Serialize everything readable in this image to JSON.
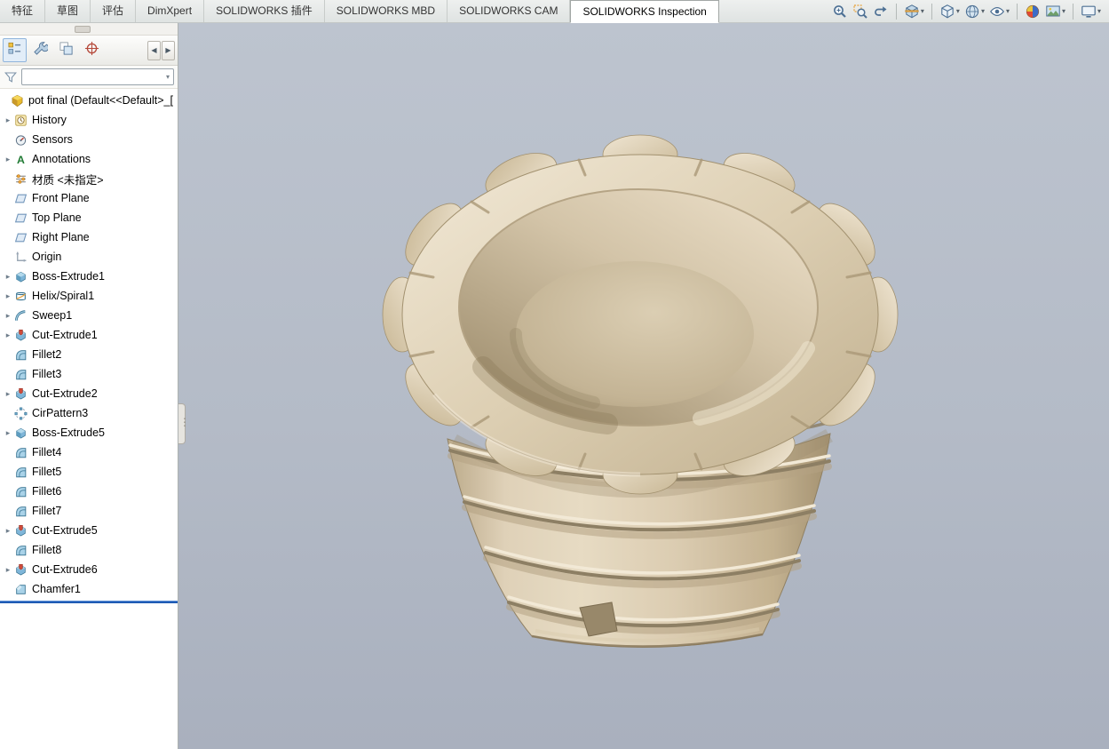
{
  "ribbon_tabs": [
    {
      "label": "特征",
      "active": false
    },
    {
      "label": "草图",
      "active": false
    },
    {
      "label": "评估",
      "active": false
    },
    {
      "label": "DimXpert",
      "active": false
    },
    {
      "label": "SOLIDWORKS 插件",
      "active": false
    },
    {
      "label": "SOLIDWORKS MBD",
      "active": false
    },
    {
      "label": "SOLIDWORKS CAM",
      "active": false
    },
    {
      "label": "SOLIDWORKS Inspection",
      "active": true
    }
  ],
  "view_toolbar": [
    {
      "name": "zoom-to-fit",
      "caret": false
    },
    {
      "name": "zoom-to-area",
      "caret": false
    },
    {
      "name": "previous-view",
      "caret": false
    },
    {
      "name": "section-view",
      "caret": true
    },
    {
      "name": "view-orientation",
      "caret": true
    },
    {
      "name": "display-style",
      "caret": true
    },
    {
      "name": "hide-show-items",
      "caret": true
    },
    {
      "name": "edit-appearance",
      "caret": false
    },
    {
      "name": "apply-scene",
      "caret": true
    },
    {
      "name": "view-settings",
      "caret": true
    }
  ],
  "panel": {
    "tabs": [
      "featuremanager-design-tree",
      "propertymanager",
      "configurationmanager",
      "dimxpertmanager"
    ],
    "filter_value": ""
  },
  "feature_tree": {
    "root_label": "pot final  (Default<<Default>_[",
    "items": [
      {
        "label": "History",
        "icon": "history",
        "arrow": true
      },
      {
        "label": "Sensors",
        "icon": "sensors",
        "arrow": false
      },
      {
        "label": "Annotations",
        "icon": "annotations",
        "arrow": true
      },
      {
        "label": "材质 <未指定>",
        "icon": "material",
        "arrow": false
      },
      {
        "label": "Front Plane",
        "icon": "plane",
        "arrow": false
      },
      {
        "label": "Top Plane",
        "icon": "plane",
        "arrow": false
      },
      {
        "label": "Right Plane",
        "icon": "plane",
        "arrow": false
      },
      {
        "label": "Origin",
        "icon": "origin",
        "arrow": false
      },
      {
        "label": "Boss-Extrude1",
        "icon": "boss-extrude",
        "arrow": true
      },
      {
        "label": "Helix/Spiral1",
        "icon": "helix",
        "arrow": true
      },
      {
        "label": "Sweep1",
        "icon": "sweep",
        "arrow": true
      },
      {
        "label": "Cut-Extrude1",
        "icon": "cut-extrude",
        "arrow": true
      },
      {
        "label": "Fillet2",
        "icon": "fillet",
        "arrow": false
      },
      {
        "label": "Fillet3",
        "icon": "fillet",
        "arrow": false
      },
      {
        "label": "Cut-Extrude2",
        "icon": "cut-extrude",
        "arrow": true
      },
      {
        "label": "CirPattern3",
        "icon": "cirpattern",
        "arrow": false
      },
      {
        "label": "Boss-Extrude5",
        "icon": "boss-extrude",
        "arrow": true
      },
      {
        "label": "Fillet4",
        "icon": "fillet",
        "arrow": false
      },
      {
        "label": "Fillet5",
        "icon": "fillet",
        "arrow": false
      },
      {
        "label": "Fillet6",
        "icon": "fillet",
        "arrow": false
      },
      {
        "label": "Fillet7",
        "icon": "fillet",
        "arrow": false
      },
      {
        "label": "Cut-Extrude5",
        "icon": "cut-extrude",
        "arrow": true
      },
      {
        "label": "Fillet8",
        "icon": "fillet",
        "arrow": false
      },
      {
        "label": "Cut-Extrude6",
        "icon": "cut-extrude",
        "arrow": true
      },
      {
        "label": "Chamfer1",
        "icon": "chamfer",
        "arrow": false
      }
    ]
  },
  "colors": {
    "viewport_bg": "#b4bbc7",
    "pot_light": "#eee3cf",
    "pot_mid": "#d8c9ae",
    "pot_dark": "#a3916f",
    "rollback_bar": "#1f5bb5"
  }
}
